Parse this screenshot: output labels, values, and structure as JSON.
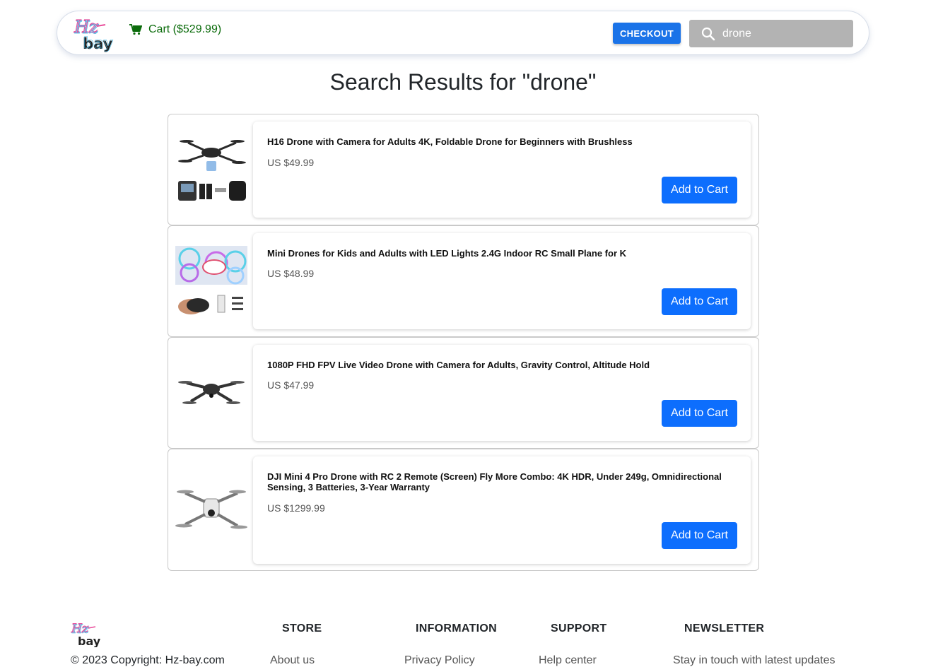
{
  "header": {
    "logo_text": "Hz-bay",
    "cart_label": "Cart ($529.99)",
    "checkout_label": "CHECKOUT",
    "search_value": "drone",
    "search_icon": "search-icon",
    "cart_icon": "cart-icon",
    "accent_color": "#1a73e8"
  },
  "page_title": "Search Results for \"drone\"",
  "results": [
    {
      "name": "H16 Drone with Camera for Adults 4K, Foldable Drone for Beginners with Brushless",
      "price": "US $49.99",
      "button": "Add to Cart"
    },
    {
      "name": "Mini Drones for Kids and Adults with LED Lights 2.4G Indoor RC Small Plane for K",
      "price": "US $48.99",
      "button": "Add to Cart"
    },
    {
      "name": "1080P FHD FPV Live Video Drone with Camera for Adults, Gravity Control, Altitude Hold",
      "price": "US $47.99",
      "button": "Add to Cart"
    },
    {
      "name": "DJI Mini 4 Pro Drone with RC 2 Remote (Screen) Fly More Combo: 4K HDR, Under 249g, Omnidirectional Sensing, 3 Batteries, 3-Year Warranty",
      "price": "US $1299.99",
      "button": "Add to Cart"
    }
  ],
  "footer": {
    "copyright": "© 2023 Copyright: Hz-bay.com",
    "columns": [
      {
        "title": "STORE",
        "link": "About us"
      },
      {
        "title": "INFORMATION",
        "link": "Privacy Policy"
      },
      {
        "title": "SUPPORT",
        "link": "Help center"
      },
      {
        "title": "NEWSLETTER",
        "link": "Stay in touch with latest updates"
      }
    ]
  }
}
